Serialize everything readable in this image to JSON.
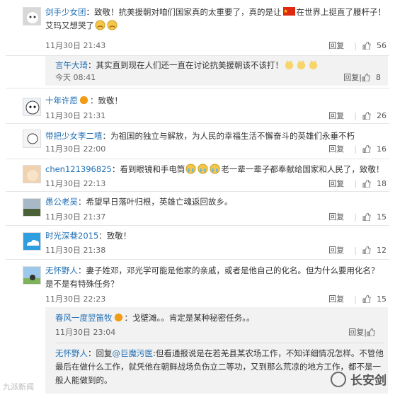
{
  "comments": [
    {
      "name": "剑手少女团",
      "text": "：致敬！抗美援朝对咱们国家真的太重要了，真的是让",
      "text2": "在世界上挺直了腰杆子！艾玛又想哭了",
      "time": "11月30日 21:43",
      "reply": "回复",
      "likes": "56"
    },
    {
      "name": "言午大琦",
      "text": "：其实直到现在人们还一直在讨论抗美援朝该不该打！",
      "time": "今天 08:41",
      "reply": "回复",
      "likes": "8"
    },
    {
      "name": "十年许愿",
      "text": "：致敬！",
      "time": "11月30日 21:31",
      "reply": "回复",
      "likes": "26"
    },
    {
      "name": "带把少女李二嘻",
      "text": "：为祖国的独立与解放，为人民的幸福生活不懈奋斗的英雄们永垂不朽",
      "time": "11月30日 22:00",
      "reply": "回复",
      "likes": "16"
    },
    {
      "name": "chen121396825",
      "text": "：看到眼镜和手电筒",
      "text2": "老一辈一辈子都奉献给国家和人民了，致敬！",
      "time": "11月30日 22:13",
      "reply": "回复",
      "likes": "18"
    },
    {
      "name": "愚公老吴",
      "text": "：希望早日落叶归根，英雄亡魂返回故乡。",
      "time": "11月30日 21:37",
      "reply": "回复",
      "likes": "15"
    },
    {
      "name": "时光深巷2015",
      "text": "：致敬！",
      "time": "11月30日 21:38",
      "reply": "回复",
      "likes": "12"
    },
    {
      "name": "无怀野人",
      "text": "：妻子姓邓，邓光学可能是他家的亲戚，或者是他自己的化名。但为什么要用化名？是不是有特殊任务？",
      "time": "11月30日 22:23",
      "reply": "回复",
      "likes": "15"
    },
    {
      "name": "春风一度翌笛牧",
      "text": "：戈壁滩。。肯定是某种秘密任务。。",
      "time": "11月30日 23:04",
      "reply": "回复",
      "likes": ""
    },
    {
      "name": "无怀野人",
      "text": "：回复",
      "mention": "@巨魔污医",
      "text2": ":但看通报说是在若羌县某农场工作，不知详细情况怎样。不管他最后在做什么工作，就凭他在朝鲜战场负伤立二等功，又到那么荒凉的地方工作，都不是一般人能做到的。",
      "time": "",
      "reply": "",
      "likes": ""
    }
  ],
  "watermark": "九派新闻",
  "brand": "长安剑"
}
